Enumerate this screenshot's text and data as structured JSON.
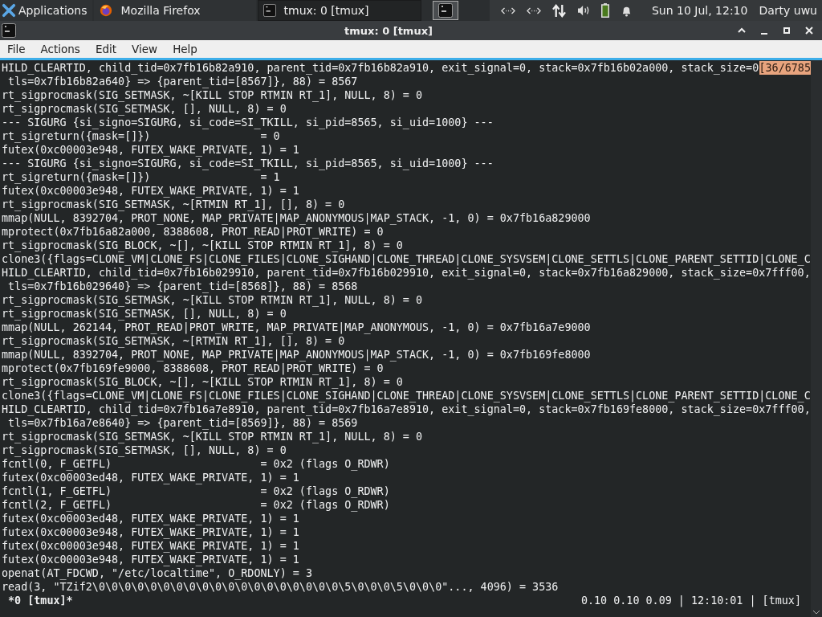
{
  "panel": {
    "launcher": "Applications",
    "tasks": [
      {
        "label": "Mozilla Firefox",
        "kind": "browser",
        "selected": false
      },
      {
        "label": "tmux: 0 [tmux]",
        "kind": "terminal",
        "selected": true
      }
    ],
    "clock": "Sun 10 Jul, 12:10",
    "user": "Darty uwu"
  },
  "window": {
    "title": "tmux: 0 [tmux]",
    "menu": [
      "File",
      "Actions",
      "Edit",
      "View",
      "Help"
    ]
  },
  "terminal": {
    "position_indicator": "[36/6785",
    "lines": [
      "HILD_CLEARTID, child_tid=0x7fb16b82a910, parent_tid=0x7fb16b82a910, exit_signal=0, stack=0x7fb16b02a000, stack_size=0",
      " tls=0x7fb16b82a640} => {parent_tid=[8567]}, 88) = 8567",
      "rt_sigprocmask(SIG_SETMASK, ~[KILL STOP RTMIN RT_1], NULL, 8) = 0",
      "rt_sigprocmask(SIG_SETMASK, [], NULL, 8) = 0",
      "--- SIGURG {si_signo=SIGURG, si_code=SI_TKILL, si_pid=8565, si_uid=1000} ---",
      "rt_sigreturn({mask=[]})                 = 0",
      "futex(0xc00003e948, FUTEX_WAKE_PRIVATE, 1) = 1",
      "--- SIGURG {si_signo=SIGURG, si_code=SI_TKILL, si_pid=8565, si_uid=1000} ---",
      "rt_sigreturn({mask=[]})                 = 1",
      "futex(0xc00003e948, FUTEX_WAKE_PRIVATE, 1) = 1",
      "rt_sigprocmask(SIG_SETMASK, ~[RTMIN RT_1], [], 8) = 0",
      "mmap(NULL, 8392704, PROT_NONE, MAP_PRIVATE|MAP_ANONYMOUS|MAP_STACK, -1, 0) = 0x7fb16a829000",
      "mprotect(0x7fb16a82a000, 8388608, PROT_READ|PROT_WRITE) = 0",
      "rt_sigprocmask(SIG_BLOCK, ~[], ~[KILL STOP RTMIN RT_1], 8) = 0",
      "clone3({flags=CLONE_VM|CLONE_FS|CLONE_FILES|CLONE_SIGHAND|CLONE_THREAD|CLONE_SYSVSEM|CLONE_SETTLS|CLONE_PARENT_SETTID|CLONE_C",
      "HILD_CLEARTID, child_tid=0x7fb16b029910, parent_tid=0x7fb16b029910, exit_signal=0, stack=0x7fb16a829000, stack_size=0x7fff00,",
      " tls=0x7fb16b029640} => {parent_tid=[8568]}, 88) = 8568",
      "rt_sigprocmask(SIG_SETMASK, ~[KILL STOP RTMIN RT_1], NULL, 8) = 0",
      "rt_sigprocmask(SIG_SETMASK, [], NULL, 8) = 0",
      "mmap(NULL, 262144, PROT_READ|PROT_WRITE, MAP_PRIVATE|MAP_ANONYMOUS, -1, 0) = 0x7fb16a7e9000",
      "rt_sigprocmask(SIG_SETMASK, ~[RTMIN RT_1], [], 8) = 0",
      "mmap(NULL, 8392704, PROT_NONE, MAP_PRIVATE|MAP_ANONYMOUS|MAP_STACK, -1, 0) = 0x7fb169fe8000",
      "mprotect(0x7fb169fe9000, 8388608, PROT_READ|PROT_WRITE) = 0",
      "rt_sigprocmask(SIG_BLOCK, ~[], ~[KILL STOP RTMIN RT_1], 8) = 0",
      "clone3({flags=CLONE_VM|CLONE_FS|CLONE_FILES|CLONE_SIGHAND|CLONE_THREAD|CLONE_SYSVSEM|CLONE_SETTLS|CLONE_PARENT_SETTID|CLONE_C",
      "HILD_CLEARTID, child_tid=0x7fb16a7e8910, parent_tid=0x7fb16a7e8910, exit_signal=0, stack=0x7fb169fe8000, stack_size=0x7fff00,",
      " tls=0x7fb16a7e8640} => {parent_tid=[8569]}, 88) = 8569",
      "rt_sigprocmask(SIG_SETMASK, ~[KILL STOP RTMIN RT_1], NULL, 8) = 0",
      "rt_sigprocmask(SIG_SETMASK, [], NULL, 8) = 0",
      "fcntl(0, F_GETFL)                       = 0x2 (flags O_RDWR)",
      "futex(0xc00003ed48, FUTEX_WAKE_PRIVATE, 1) = 1",
      "fcntl(1, F_GETFL)                       = 0x2 (flags O_RDWR)",
      "fcntl(2, F_GETFL)                       = 0x2 (flags O_RDWR)",
      "futex(0xc00003ed48, FUTEX_WAKE_PRIVATE, 1) = 1",
      "futex(0xc00003e948, FUTEX_WAKE_PRIVATE, 1) = 1",
      "futex(0xc00003e948, FUTEX_WAKE_PRIVATE, 1) = 1",
      "futex(0xc00003e948, FUTEX_WAKE_PRIVATE, 1) = 1",
      "openat(AT_FDCWD, \"/etc/localtime\", O_RDONLY) = 3",
      "read(3, \"TZif2\\0\\0\\0\\0\\0\\0\\0\\0\\0\\0\\0\\0\\0\\0\\0\\0\\0\\0\\0\\5\\0\\0\\0\\5\\0\\0\\0\"..., 4096) = 3536"
    ],
    "status_left": " *0 [tmux]*",
    "status_right": "0.10 0.10 0.09 | 12:10:01 | [tmux]"
  }
}
